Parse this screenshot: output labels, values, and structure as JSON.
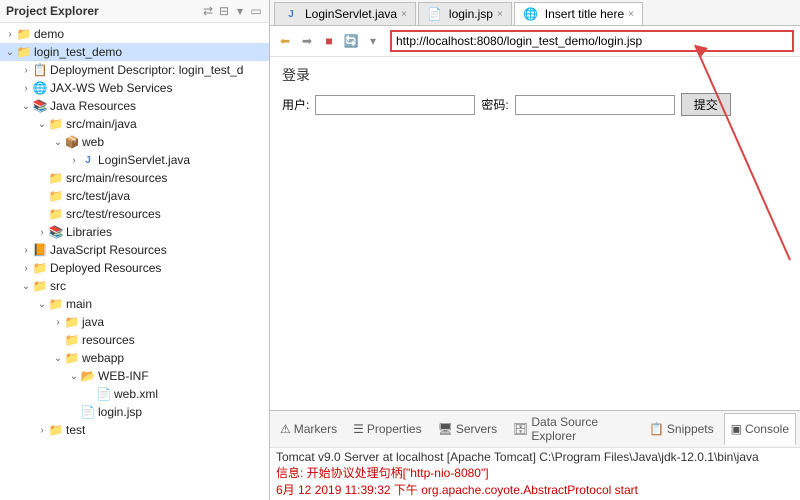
{
  "explorer": {
    "title": "Project Explorer",
    "tree": {
      "demo": "demo",
      "login_test_demo": "login_test_demo",
      "deploy_desc": "Deployment Descriptor: login_test_d",
      "jaxws": "JAX-WS Web Services",
      "java_res": "Java Resources",
      "src_main_java": "src/main/java",
      "web_pkg": "web",
      "login_servlet": "LoginServlet.java",
      "src_main_res": "src/main/resources",
      "src_test_java": "src/test/java",
      "src_test_res": "src/test/resources",
      "libraries": "Libraries",
      "js_res": "JavaScript Resources",
      "deployed": "Deployed Resources",
      "src": "src",
      "main": "main",
      "java": "java",
      "resources": "resources",
      "webapp": "webapp",
      "webinf": "WEB-INF",
      "webxml": "web.xml",
      "loginjsp": "login.jsp",
      "test": "test"
    }
  },
  "tabs": {
    "t1": "LoginServlet.java",
    "t2": "login.jsp",
    "t3": "Insert title here"
  },
  "browser": {
    "url": "http://localhost:8080/login_test_demo/login.jsp"
  },
  "page": {
    "login_heading": "登录",
    "user_label": "用户:",
    "pass_label": "密码:",
    "submit_label": "提交"
  },
  "bottom": {
    "markers": "Markers",
    "properties": "Properties",
    "servers": "Servers",
    "dse": "Data Source Explorer",
    "snippets": "Snippets",
    "console": "Console",
    "console_title": "Tomcat v9.0 Server at localhost [Apache Tomcat] C:\\Program Files\\Java\\jdk-12.0.1\\bin\\java",
    "line1": "信息: 开始协议处理句柄[\"http-nio-8080\"]",
    "line2": "6月 12 2019 11:39:32 下午 org.apache.coyote.AbstractProtocol start"
  }
}
